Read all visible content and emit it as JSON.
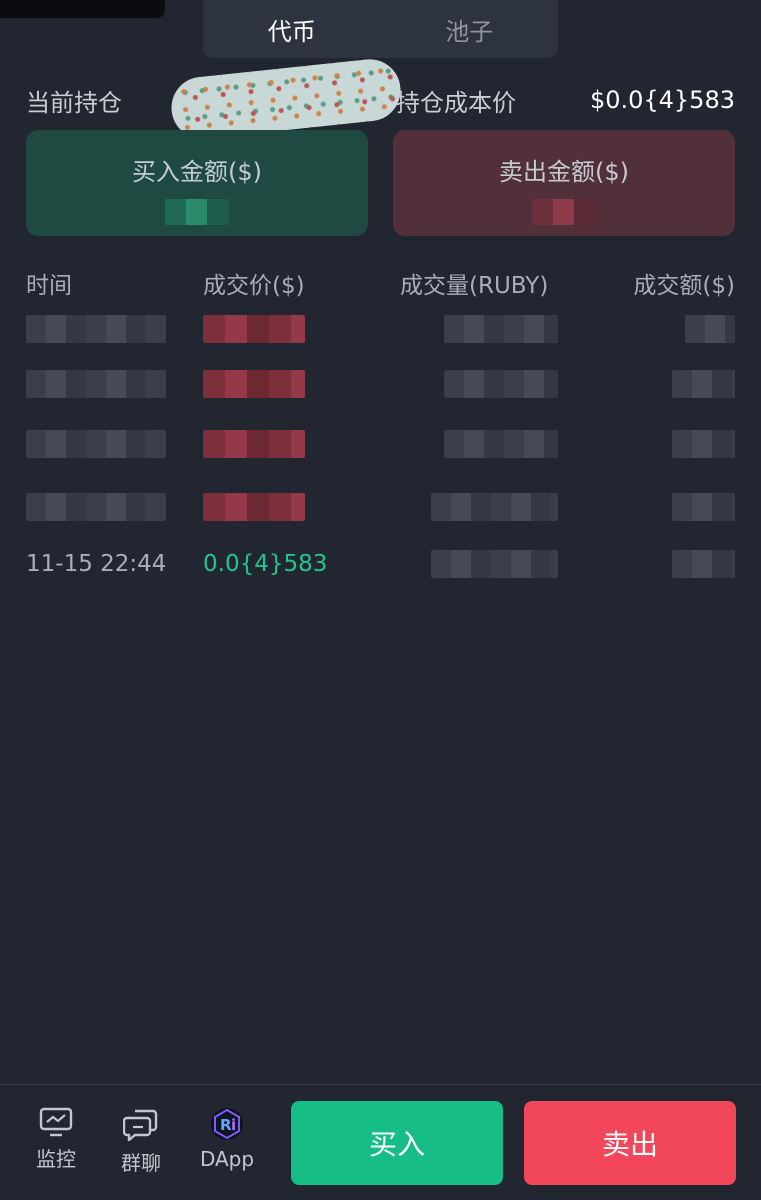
{
  "tabs": [
    {
      "label": "代币",
      "active": true
    },
    {
      "label": "池子",
      "active": false
    }
  ],
  "position": {
    "current_label": "当前持仓",
    "cost_label": "持仓成本价",
    "cost_value": "$0.0{4}583"
  },
  "amounts": {
    "buy_label": "买入金额($)",
    "sell_label": "卖出金额($)"
  },
  "table": {
    "headers": [
      "时间",
      "成交价($)",
      "成交量(RUBY)",
      "成交额($)"
    ],
    "last_row": {
      "time": "11-15 22:44",
      "price": "0.0{4}583"
    }
  },
  "bottom_nav": [
    {
      "label": "监控",
      "icon": "monitor-icon"
    },
    {
      "label": "群聊",
      "icon": "chat-icon"
    },
    {
      "label": "DApp",
      "icon": "dapp-icon"
    }
  ],
  "actions": {
    "buy_label": "买入",
    "sell_label": "卖出"
  },
  "colors": {
    "background": "#222630",
    "buy_green": "#16bd87",
    "sell_red": "#f2465b",
    "price_green": "#22c48b"
  }
}
